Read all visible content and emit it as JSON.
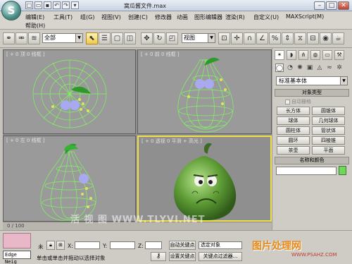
{
  "title_bar": {
    "logo": "3ds-max-logo",
    "quick_icons": [
      "new-icon",
      "open-icon",
      "save-icon",
      "undo-icon",
      "redo-icon"
    ],
    "redo_glyph": "↷",
    "dropdown_glyph": "▾",
    "file_name": "窝瓜酱文件.max",
    "minimize": "–",
    "maximize": "□",
    "close": "✕"
  },
  "menu": {
    "items": [
      "编辑(E)",
      "工具(T)",
      "组(G)",
      "视图(V)",
      "创建(C)",
      "修改器",
      "动画",
      "图形编辑器",
      "渲染(R)",
      "自定义(U)",
      "MAXScript(M)",
      "帮助(H)"
    ]
  },
  "toolbar": {
    "selection_filter": "全部",
    "reference_coord": "视图",
    "icons": [
      "link-icon",
      "unlink-icon",
      "bind-icon",
      "select-object-icon",
      "select-by-name-icon",
      "rect-selection-icon",
      "window-crossing-icon",
      "move-icon",
      "rotate-icon",
      "scale-icon",
      "pivot-icon",
      "select-manipulate-icon",
      "snap-3d-icon",
      "angle-snap-icon",
      "percent-snap-icon",
      "spinner-snap-icon",
      "mirror-icon",
      "align-icon",
      "layers-icon",
      "curve-editor-icon",
      "schematic-icon",
      "material-editor-icon",
      "render-setup-icon",
      "render-icon",
      "teapot-render-icon"
    ]
  },
  "viewports": [
    {
      "label": "[ + 0 顶 0 线框 ]"
    },
    {
      "label": "[ + 0 前 0 线框 ]"
    },
    {
      "label": "[ + 0 左 0 线框 ]"
    },
    {
      "label": "[ + 0 透视 0 平滑 + 高光 ]"
    }
  ],
  "command_panel": {
    "tabs": [
      "create-icon",
      "modify-icon",
      "hierarchy-icon",
      "motion-icon",
      "display-icon",
      "utilities-icon"
    ],
    "sub_tabs": [
      "geometry-icon",
      "shapes-icon",
      "lights-icon",
      "cameras-icon",
      "helpers-icon",
      "space-warps-icon",
      "systems-icon"
    ],
    "category": "标准基本体",
    "object_type_header": "对象类型",
    "auto_grid": "自动栅格",
    "buttons": [
      "长方体",
      "圆锥体",
      "球体",
      "几何球体",
      "圆柱体",
      "管状体",
      "圆环",
      "四棱锥",
      "茶壶",
      "平面"
    ],
    "name_color_header": "名称和颜色",
    "color": "#6fd85a"
  },
  "time_slider": {
    "text": "0 / 100"
  },
  "status_bar": {
    "edge_label": "Edge Neig",
    "selection_status": "未",
    "prompt": "单击或单击并拖动以选择对象",
    "x_label": "X:",
    "y_label": "Y:",
    "z_label": "Z:",
    "auto_key": "自动关键点",
    "set_key": "设置关键点",
    "selected_object": "选定对象",
    "key_filters": "关键点过滤器..."
  },
  "watermarks": {
    "left": "活 视 图  WWW.TLYVI.NET",
    "brand_cn": "图片处理网",
    "brand_url": "WWW.PSAHZ.COM"
  }
}
